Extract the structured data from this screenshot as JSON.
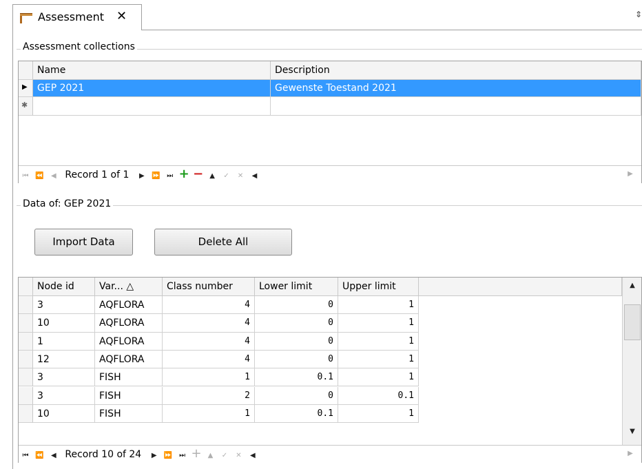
{
  "tab": {
    "title": "Assessment",
    "close_glyph": "✕"
  },
  "pin_glyph": "⇕",
  "collections": {
    "group_title": "Assessment collections",
    "columns": [
      "Name",
      "Description"
    ],
    "rows": [
      {
        "name": "GEP 2021",
        "description": "Gewenste Toestand 2021",
        "selected": true
      }
    ],
    "new_row_glyph": "✱",
    "record_text": "Record 1 of 1"
  },
  "data_section": {
    "group_title": "Data of: GEP 2021",
    "import_button": "Import Data",
    "delete_button": "Delete All",
    "columns": [
      "Node id",
      "Var... △",
      "Class number",
      "Lower limit",
      "Upper limit"
    ],
    "rows": [
      [
        "3",
        "AQFLORA",
        "4",
        "0",
        "1"
      ],
      [
        "10",
        "AQFLORA",
        "4",
        "0",
        "1"
      ],
      [
        "1",
        "AQFLORA",
        "4",
        "0",
        "1"
      ],
      [
        "12",
        "AQFLORA",
        "4",
        "0",
        "1"
      ],
      [
        "3",
        "FISH",
        "1",
        "0.1",
        "1"
      ],
      [
        "3",
        "FISH",
        "2",
        "0",
        "0.1"
      ],
      [
        "10",
        "FISH",
        "1",
        "0.1",
        "1"
      ]
    ],
    "record_text": "Record 10 of 24",
    "scroll_position": 0.12
  },
  "colors": {
    "selection": "#3399ff",
    "plus": "#1a9a1a",
    "minus": "#d02020"
  },
  "icons": {
    "first": "⏮",
    "prev_page": "⏪",
    "prev": "◀",
    "next": "▶",
    "next_page": "⏩",
    "last": "⏭",
    "add": "+",
    "remove": "−",
    "up": "▲",
    "check": "✓",
    "cancel": "✕",
    "scroll_left": "◀",
    "scroll_right": "▶",
    "scroll_up": "▲",
    "scroll_down": "▼",
    "row_pointer": "▶"
  }
}
